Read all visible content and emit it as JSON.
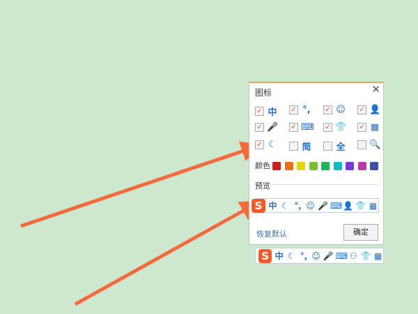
{
  "dialog": {
    "title": "图标",
    "close": "✕",
    "options": [
      {
        "icon": "中",
        "name": "chinese-mode",
        "checked": true
      },
      {
        "icon": "°,",
        "name": "punctuation",
        "checked": true
      },
      {
        "icon": "☺",
        "name": "emoji",
        "checked": true
      },
      {
        "icon": "👤",
        "name": "user",
        "checked": true
      },
      {
        "icon": "🎤",
        "name": "microphone",
        "checked": true
      },
      {
        "icon": "⌨",
        "name": "keyboard",
        "checked": true
      },
      {
        "icon": "👕",
        "name": "skin",
        "checked": true
      },
      {
        "icon": "▦",
        "name": "toolbox",
        "checked": true
      },
      {
        "icon": "☾",
        "name": "moon",
        "checked": true
      },
      {
        "icon": "简",
        "name": "simplified",
        "checked": false
      },
      {
        "icon": "全",
        "name": "full-width",
        "checked": false
      },
      {
        "icon": "🔍",
        "name": "search",
        "checked": false
      }
    ],
    "color_label": "颜色",
    "colors": [
      "#c8201f",
      "#e8701a",
      "#e3d40c",
      "#7cbd33",
      "#1fb45a",
      "#14b9c4",
      "#7a39d4",
      "#bd3aa6",
      "#3f4fa6"
    ],
    "preview_label": "预览",
    "preview_icons": [
      "中",
      "☾",
      "°,",
      "☺",
      "🎤",
      "⌨",
      "👤",
      "👕",
      "▦"
    ],
    "restore_label": "恢复默认",
    "ok_label": "确定"
  },
  "logo": "S",
  "toolbar_icons": [
    "中",
    "☾",
    "°,",
    "☺",
    "🎤",
    "⌨",
    "⚇",
    "👕",
    "▦"
  ],
  "arrow_color": "#f46a3c"
}
